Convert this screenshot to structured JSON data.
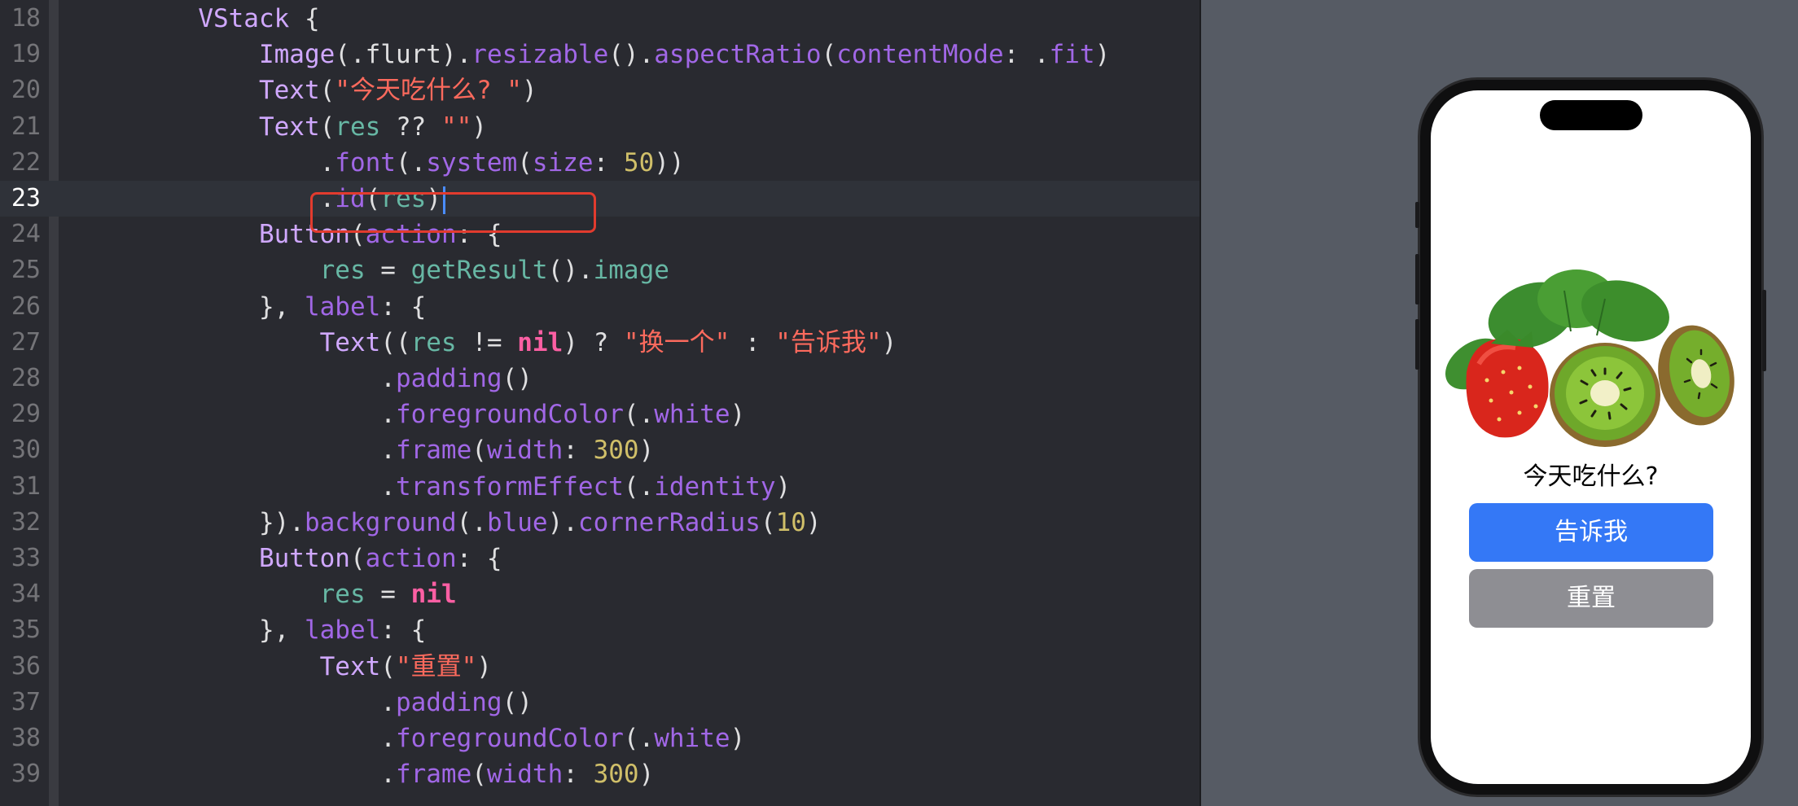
{
  "editor": {
    "lines": [
      {
        "n": "18",
        "tokens": [
          [
            "pl",
            "        "
          ],
          [
            "typ",
            "VStack"
          ],
          [
            "pl",
            " {"
          ]
        ]
      },
      {
        "n": "19",
        "tokens": [
          [
            "pl",
            "            "
          ],
          [
            "typ",
            "Image"
          ],
          [
            "pl",
            "(.flurt)."
          ],
          [
            "fn",
            "resizable"
          ],
          [
            "pl",
            "()."
          ],
          [
            "fn",
            "aspectRatio"
          ],
          [
            "pl",
            "("
          ],
          [
            "prop",
            "contentMode"
          ],
          [
            "pl",
            ": ."
          ],
          [
            "prop",
            "fit"
          ],
          [
            "pl",
            ")"
          ]
        ]
      },
      {
        "n": "20",
        "tokens": [
          [
            "pl",
            "            "
          ],
          [
            "typ",
            "Text"
          ],
          [
            "pl",
            "("
          ],
          [
            "str",
            "\"今天吃什么? \""
          ],
          [
            "pl",
            ")"
          ]
        ]
      },
      {
        "n": "21",
        "tokens": [
          [
            "pl",
            "            "
          ],
          [
            "typ",
            "Text"
          ],
          [
            "pl",
            "("
          ],
          [
            "var",
            "res"
          ],
          [
            "pl",
            " ?? "
          ],
          [
            "str",
            "\"\""
          ],
          [
            "pl",
            ")"
          ]
        ]
      },
      {
        "n": "22",
        "tokens": [
          [
            "pl",
            "                ."
          ],
          [
            "fn",
            "font"
          ],
          [
            "pl",
            "(."
          ],
          [
            "fn",
            "system"
          ],
          [
            "pl",
            "("
          ],
          [
            "prop",
            "size"
          ],
          [
            "pl",
            ": "
          ],
          [
            "num",
            "50"
          ],
          [
            "pl",
            "))"
          ]
        ]
      },
      {
        "n": "23",
        "current": true,
        "cursor": true,
        "tokens": [
          [
            "pl",
            "                ."
          ],
          [
            "fn",
            "id"
          ],
          [
            "pl",
            "("
          ],
          [
            "var",
            "res"
          ],
          [
            "pl",
            ")"
          ]
        ]
      },
      {
        "n": "24",
        "tokens": [
          [
            "pl",
            "            "
          ],
          [
            "typ",
            "Button"
          ],
          [
            "pl",
            "("
          ],
          [
            "prop",
            "action"
          ],
          [
            "pl",
            ": {"
          ]
        ]
      },
      {
        "n": "25",
        "tokens": [
          [
            "pl",
            "                "
          ],
          [
            "var",
            "res"
          ],
          [
            "pl",
            " = "
          ],
          [
            "var",
            "getResult"
          ],
          [
            "pl",
            "()."
          ],
          [
            "var",
            "image"
          ]
        ]
      },
      {
        "n": "26",
        "tokens": [
          [
            "pl",
            "            }, "
          ],
          [
            "prop",
            "label"
          ],
          [
            "pl",
            ": {"
          ]
        ]
      },
      {
        "n": "27",
        "tokens": [
          [
            "pl",
            "                "
          ],
          [
            "typ",
            "Text"
          ],
          [
            "pl",
            "(("
          ],
          [
            "var",
            "res"
          ],
          [
            "pl",
            " != "
          ],
          [
            "kw",
            "nil"
          ],
          [
            "pl",
            ") ? "
          ],
          [
            "str",
            "\"换一个\""
          ],
          [
            "pl",
            " : "
          ],
          [
            "str",
            "\"告诉我\""
          ],
          [
            "pl",
            ")"
          ]
        ]
      },
      {
        "n": "28",
        "tokens": [
          [
            "pl",
            "                    ."
          ],
          [
            "fn",
            "padding"
          ],
          [
            "pl",
            "()"
          ]
        ]
      },
      {
        "n": "29",
        "tokens": [
          [
            "pl",
            "                    ."
          ],
          [
            "fn",
            "foregroundColor"
          ],
          [
            "pl",
            "(."
          ],
          [
            "prop",
            "white"
          ],
          [
            "pl",
            ")"
          ]
        ]
      },
      {
        "n": "30",
        "tokens": [
          [
            "pl",
            "                    ."
          ],
          [
            "fn",
            "frame"
          ],
          [
            "pl",
            "("
          ],
          [
            "prop",
            "width"
          ],
          [
            "pl",
            ": "
          ],
          [
            "num",
            "300"
          ],
          [
            "pl",
            ")"
          ]
        ]
      },
      {
        "n": "31",
        "tokens": [
          [
            "pl",
            "                    ."
          ],
          [
            "fn",
            "transformEffect"
          ],
          [
            "pl",
            "(."
          ],
          [
            "prop",
            "identity"
          ],
          [
            "pl",
            ")"
          ]
        ]
      },
      {
        "n": "32",
        "tokens": [
          [
            "pl",
            "            })."
          ],
          [
            "fn",
            "background"
          ],
          [
            "pl",
            "(."
          ],
          [
            "prop",
            "blue"
          ],
          [
            "pl",
            ")."
          ],
          [
            "fn",
            "cornerRadius"
          ],
          [
            "pl",
            "("
          ],
          [
            "num",
            "10"
          ],
          [
            "pl",
            ")"
          ]
        ]
      },
      {
        "n": "33",
        "tokens": [
          [
            "pl",
            "            "
          ],
          [
            "typ",
            "Button"
          ],
          [
            "pl",
            "("
          ],
          [
            "prop",
            "action"
          ],
          [
            "pl",
            ": {"
          ]
        ]
      },
      {
        "n": "34",
        "tokens": [
          [
            "pl",
            "                "
          ],
          [
            "var",
            "res"
          ],
          [
            "pl",
            " = "
          ],
          [
            "kw",
            "nil"
          ]
        ]
      },
      {
        "n": "35",
        "tokens": [
          [
            "pl",
            "            }, "
          ],
          [
            "prop",
            "label"
          ],
          [
            "pl",
            ": {"
          ]
        ]
      },
      {
        "n": "36",
        "tokens": [
          [
            "pl",
            "                "
          ],
          [
            "typ",
            "Text"
          ],
          [
            "pl",
            "("
          ],
          [
            "str",
            "\"重置\""
          ],
          [
            "pl",
            ")"
          ]
        ]
      },
      {
        "n": "37",
        "tokens": [
          [
            "pl",
            "                    ."
          ],
          [
            "fn",
            "padding"
          ],
          [
            "pl",
            "()"
          ]
        ]
      },
      {
        "n": "38",
        "tokens": [
          [
            "pl",
            "                    ."
          ],
          [
            "fn",
            "foregroundColor"
          ],
          [
            "pl",
            "(."
          ],
          [
            "prop",
            "white"
          ],
          [
            "pl",
            ")"
          ]
        ]
      },
      {
        "n": "39",
        "tokens": [
          [
            "pl",
            "                    ."
          ],
          [
            "fn",
            "frame"
          ],
          [
            "pl",
            "("
          ],
          [
            "prop",
            "width"
          ],
          [
            "pl",
            ": "
          ],
          [
            "num",
            "300"
          ],
          [
            "pl",
            ")"
          ]
        ]
      }
    ]
  },
  "preview": {
    "title": "今天吃什么?",
    "tell_button": "告诉我",
    "reset_button": "重置",
    "colors": {
      "tell": "#3478f6",
      "reset": "#8e8e93"
    }
  }
}
